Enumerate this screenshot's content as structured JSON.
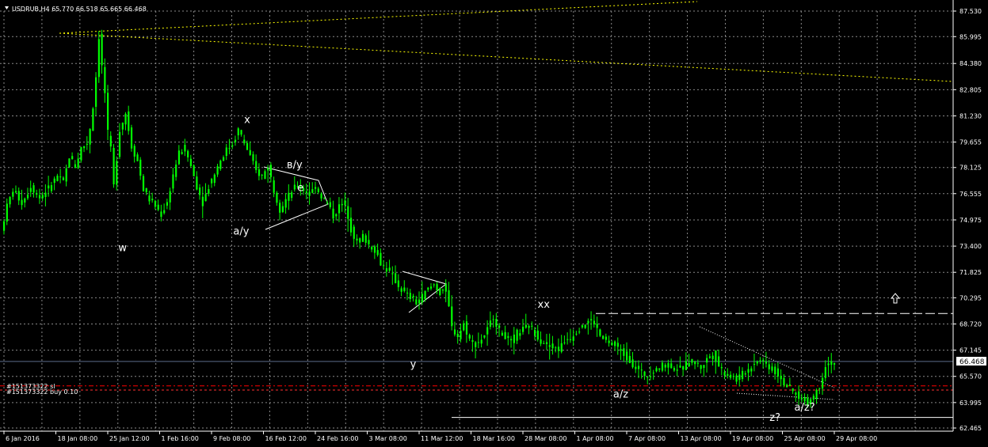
{
  "header": {
    "title": "USDRUB,H4  65.770 66.518 65.665 66.468"
  },
  "orders": {
    "line1": "#151373322 sl",
    "line2": "#151373322 buy 0.10"
  },
  "current_price_tag": "66.468",
  "colors": {
    "background": "#000000",
    "grid": "#808080",
    "candle": "#00ff00",
    "sl_line": "#ff0000",
    "trend_dotted": "#ffff00",
    "text": "#ffffff",
    "annotation_yellow": "#ffff00"
  },
  "chart_data": {
    "type": "candlestick",
    "symbol": "USDRUB",
    "timeframe": "H4",
    "ohlc": {
      "open": 65.77,
      "high": 66.518,
      "low": 65.665,
      "close": 66.468
    },
    "y_ticks": [
      "87.530",
      "85.995",
      "84.380",
      "82.805",
      "81.230",
      "79.655",
      "78.125",
      "76.555",
      "74.975",
      "73.400",
      "71.825",
      "70.295",
      "68.720",
      "67.145",
      "65.570",
      "63.995",
      "62.465"
    ],
    "x_ticks": [
      "6 Jan 2016",
      "18 Jan 08:00",
      "25 Jan 12:00",
      "1 Feb 16:00",
      "9 Feb 08:00",
      "16 Feb 12:00",
      "24 Feb 16:00",
      "3 Mar 08:00",
      "11 Mar 12:00",
      "18 Mar 16:00",
      "28 Mar 08:00",
      "1 Apr 08:00",
      "7 Apr 08:00",
      "13 Apr 08:00",
      "19 Apr 08:00",
      "25 Apr 08:00",
      "29 Apr 08:00"
    ],
    "ylim": [
      62.465,
      87.53
    ],
    "path": [
      {
        "x": 0,
        "y": 74.3
      },
      {
        "x": 2,
        "y": 75.8
      },
      {
        "x": 4,
        "y": 76.8
      },
      {
        "x": 7,
        "y": 76.0
      },
      {
        "x": 10,
        "y": 77.0
      },
      {
        "x": 13,
        "y": 76.3
      },
      {
        "x": 16,
        "y": 76.9
      },
      {
        "x": 19,
        "y": 77.6
      },
      {
        "x": 21,
        "y": 77.2
      },
      {
        "x": 23,
        "y": 78.8
      },
      {
        "x": 25,
        "y": 78.2
      },
      {
        "x": 27,
        "y": 79.3
      },
      {
        "x": 29,
        "y": 79.6
      },
      {
        "x": 30,
        "y": 80.5
      },
      {
        "x": 31,
        "y": 81.8
      },
      {
        "x": 32,
        "y": 83.6
      },
      {
        "x": 33,
        "y": 86.0
      },
      {
        "x": 34,
        "y": 84.2
      },
      {
        "x": 35,
        "y": 82.6
      },
      {
        "x": 36,
        "y": 80.2
      },
      {
        "x": 37,
        "y": 79.2
      },
      {
        "x": 38,
        "y": 77.0
      },
      {
        "x": 40,
        "y": 80.4
      },
      {
        "x": 42,
        "y": 81.4
      },
      {
        "x": 44,
        "y": 79.4
      },
      {
        "x": 46,
        "y": 78.5
      },
      {
        "x": 48,
        "y": 76.8
      },
      {
        "x": 50,
        "y": 76.2
      },
      {
        "x": 52,
        "y": 75.8
      },
      {
        "x": 54,
        "y": 75.3
      },
      {
        "x": 56,
        "y": 76.0
      },
      {
        "x": 58,
        "y": 77.7
      },
      {
        "x": 60,
        "y": 79.0
      },
      {
        "x": 62,
        "y": 79.3
      },
      {
        "x": 64,
        "y": 78.2
      },
      {
        "x": 66,
        "y": 77.0
      },
      {
        "x": 68,
        "y": 76.0
      },
      {
        "x": 70,
        "y": 77.0
      },
      {
        "x": 72,
        "y": 77.8
      },
      {
        "x": 74,
        "y": 78.6
      },
      {
        "x": 76,
        "y": 79.2
      },
      {
        "x": 78,
        "y": 79.5
      },
      {
        "x": 80,
        "y": 80.4
      },
      {
        "x": 82,
        "y": 79.6
      },
      {
        "x": 84,
        "y": 78.8
      },
      {
        "x": 86,
        "y": 77.9
      },
      {
        "x": 88,
        "y": 77.6
      },
      {
        "x": 90,
        "y": 78.2
      },
      {
        "x": 92,
        "y": 76.8
      },
      {
        "x": 94,
        "y": 75.6
      },
      {
        "x": 96,
        "y": 76.2
      },
      {
        "x": 98,
        "y": 76.7
      },
      {
        "x": 100,
        "y": 77.1
      },
      {
        "x": 102,
        "y": 76.8
      },
      {
        "x": 104,
        "y": 76.5
      },
      {
        "x": 106,
        "y": 77.0
      },
      {
        "x": 108,
        "y": 76.4
      },
      {
        "x": 110,
        "y": 76.0
      },
      {
        "x": 112,
        "y": 75.2
      },
      {
        "x": 114,
        "y": 75.8
      },
      {
        "x": 116,
        "y": 76.0
      },
      {
        "x": 118,
        "y": 74.4
      },
      {
        "x": 120,
        "y": 73.6
      },
      {
        "x": 122,
        "y": 74.0
      },
      {
        "x": 124,
        "y": 73.5
      },
      {
        "x": 126,
        "y": 73.2
      },
      {
        "x": 128,
        "y": 72.4
      },
      {
        "x": 130,
        "y": 72.0
      },
      {
        "x": 132,
        "y": 71.6
      },
      {
        "x": 134,
        "y": 71.0
      },
      {
        "x": 136,
        "y": 70.6
      },
      {
        "x": 138,
        "y": 70.3
      },
      {
        "x": 140,
        "y": 70.0
      },
      {
        "x": 142,
        "y": 70.4
      },
      {
        "x": 144,
        "y": 70.8
      },
      {
        "x": 146,
        "y": 71.1
      },
      {
        "x": 148,
        "y": 70.6
      },
      {
        "x": 150,
        "y": 70.9
      },
      {
        "x": 152,
        "y": 68.5
      },
      {
        "x": 154,
        "y": 68.0
      },
      {
        "x": 156,
        "y": 68.7
      },
      {
        "x": 158,
        "y": 67.8
      },
      {
        "x": 160,
        "y": 67.5
      },
      {
        "x": 162,
        "y": 67.8
      },
      {
        "x": 164,
        "y": 68.4
      },
      {
        "x": 166,
        "y": 69.2
      },
      {
        "x": 168,
        "y": 68.3
      },
      {
        "x": 170,
        "y": 68.0
      },
      {
        "x": 172,
        "y": 67.6
      },
      {
        "x": 174,
        "y": 68.2
      },
      {
        "x": 176,
        "y": 68.4
      },
      {
        "x": 178,
        "y": 68.6
      },
      {
        "x": 180,
        "y": 68.2
      },
      {
        "x": 182,
        "y": 67.7
      },
      {
        "x": 184,
        "y": 67.5
      },
      {
        "x": 186,
        "y": 67.4
      },
      {
        "x": 188,
        "y": 67.2
      },
      {
        "x": 190,
        "y": 67.7
      },
      {
        "x": 192,
        "y": 67.9
      },
      {
        "x": 194,
        "y": 68.3
      },
      {
        "x": 196,
        "y": 68.6
      },
      {
        "x": 198,
        "y": 68.9
      },
      {
        "x": 200,
        "y": 68.8
      },
      {
        "x": 202,
        "y": 68.0
      },
      {
        "x": 204,
        "y": 67.7
      },
      {
        "x": 206,
        "y": 67.5
      },
      {
        "x": 208,
        "y": 67.3
      },
      {
        "x": 210,
        "y": 66.9
      },
      {
        "x": 212,
        "y": 66.5
      },
      {
        "x": 214,
        "y": 66.1
      },
      {
        "x": 216,
        "y": 65.8
      },
      {
        "x": 218,
        "y": 65.6
      },
      {
        "x": 220,
        "y": 65.9
      },
      {
        "x": 222,
        "y": 66.1
      },
      {
        "x": 224,
        "y": 66.3
      },
      {
        "x": 226,
        "y": 66.2
      },
      {
        "x": 228,
        "y": 66.0
      },
      {
        "x": 230,
        "y": 66.1
      },
      {
        "x": 232,
        "y": 66.5
      },
      {
        "x": 234,
        "y": 66.4
      },
      {
        "x": 236,
        "y": 66.1
      },
      {
        "x": 238,
        "y": 66.6
      },
      {
        "x": 240,
        "y": 67.0
      },
      {
        "x": 242,
        "y": 66.2
      },
      {
        "x": 244,
        "y": 65.8
      },
      {
        "x": 246,
        "y": 65.6
      },
      {
        "x": 248,
        "y": 65.4
      },
      {
        "x": 250,
        "y": 65.7
      },
      {
        "x": 252,
        "y": 66.0
      },
      {
        "x": 254,
        "y": 66.4
      },
      {
        "x": 256,
        "y": 66.6
      },
      {
        "x": 258,
        "y": 66.3
      },
      {
        "x": 260,
        "y": 66.0
      },
      {
        "x": 262,
        "y": 65.7
      },
      {
        "x": 264,
        "y": 65.2
      },
      {
        "x": 266,
        "y": 64.8
      },
      {
        "x": 268,
        "y": 64.5
      },
      {
        "x": 270,
        "y": 64.2
      },
      {
        "x": 272,
        "y": 64.0
      },
      {
        "x": 274,
        "y": 64.4
      },
      {
        "x": 276,
        "y": 65.0
      },
      {
        "x": 278,
        "y": 66.3
      },
      {
        "x": 280,
        "y": 66.4
      }
    ],
    "horizontal_lines": {
      "current_price": 66.468,
      "stop_loss": 65.0,
      "buy": 64.75,
      "xx_level": 69.35,
      "bottom_support": 63.1
    },
    "annotations": [
      {
        "text": "x",
        "x": 82,
        "y": 80.8
      },
      {
        "text": "w",
        "x": 40,
        "y": 73.1
      },
      {
        "text": "в/у",
        "x": 98,
        "y": 78.1
      },
      {
        "text": "e",
        "x": 100,
        "y": 76.7
      },
      {
        "text": "a/y",
        "x": 80,
        "y": 74.1
      },
      {
        "text": "y",
        "x": 138,
        "y": 66.1
      },
      {
        "text": "xx",
        "x": 182,
        "y": 69.7
      },
      {
        "text": "a/z",
        "x": 208,
        "y": 64.3
      },
      {
        "text": "a/z?",
        "x": 270,
        "y": 63.5
      },
      {
        "text": "z?",
        "x": 260,
        "y": 62.9
      }
    ]
  }
}
